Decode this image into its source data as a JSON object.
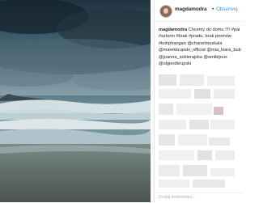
{
  "post": {
    "username": "magdamodra",
    "separator": "•",
    "follow_label": "Obserwuj"
  },
  "caption": {
    "author": "magdamodra",
    "lines": [
      "Chcemy do domu !!!! #pai",
      "#sztorm #brak #pradu, brak promów",
      "#kohphangan @chanelmuskala",
      "@marekkrupski_official @mia_kiara_bub",
      "@joanna_sobierajska @amibijoux",
      "@olgierdkrupski"
    ],
    "first_line_rest": " Chcemy do domu !!!! #pai"
  },
  "comment_box": {
    "placeholder": "Dodaj komentarz..."
  },
  "colors": {
    "link": "#3897f0",
    "text": "#262626",
    "muted": "#b0b0b0"
  }
}
